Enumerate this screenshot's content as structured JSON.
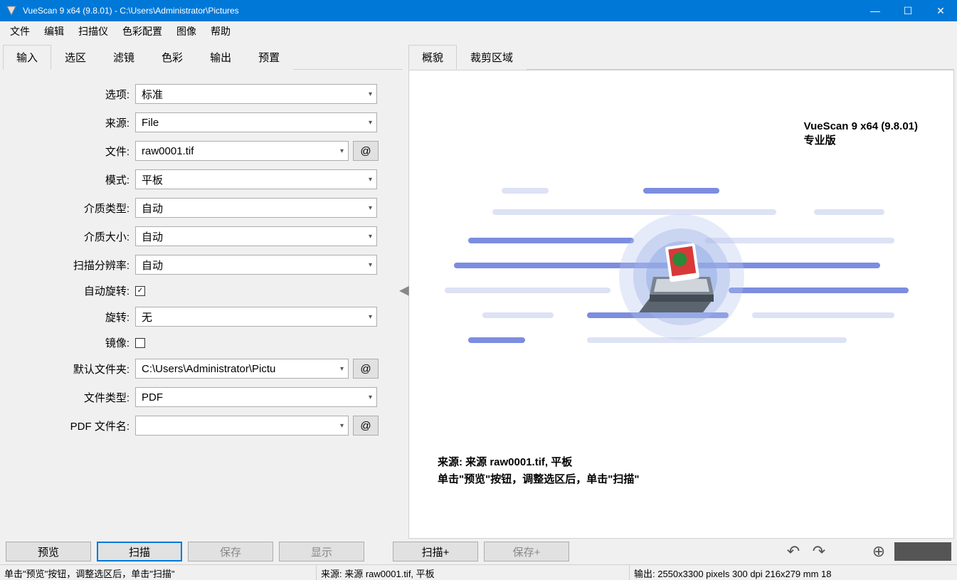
{
  "window": {
    "title": "VueScan 9 x64 (9.8.01) - C:\\Users\\Administrator\\Pictures",
    "minimize": "—",
    "maximize": "☐",
    "close": "✕"
  },
  "menu": [
    "文件",
    "编辑",
    "扫描仪",
    "色彩配置",
    "图像",
    "帮助"
  ],
  "left_tabs": [
    {
      "label": "输入",
      "active": true
    },
    {
      "label": "选区",
      "active": false
    },
    {
      "label": "滤镜",
      "active": false
    },
    {
      "label": "色彩",
      "active": false
    },
    {
      "label": "输出",
      "active": false
    },
    {
      "label": "预置",
      "active": false
    }
  ],
  "right_tabs": [
    {
      "label": "概貌",
      "active": true
    },
    {
      "label": "裁剪区域",
      "active": false
    }
  ],
  "form": {
    "options": {
      "label": "选项:",
      "value": "标准"
    },
    "source": {
      "label": "来源:",
      "value": "File"
    },
    "file": {
      "label": "文件:",
      "value": "raw0001.tif",
      "at": "@"
    },
    "mode": {
      "label": "模式:",
      "value": "平板"
    },
    "media_type": {
      "label": "介质类型:",
      "value": "自动"
    },
    "media_size": {
      "label": "介质大小:",
      "value": "自动"
    },
    "scan_resolution": {
      "label": "扫描分辨率:",
      "value": "自动"
    },
    "auto_rotate": {
      "label": "自动旋转:",
      "checked": true
    },
    "rotate": {
      "label": "旋转:",
      "value": "无"
    },
    "mirror": {
      "label": "镜像:",
      "checked": false
    },
    "default_folder": {
      "label": "默认文件夹:",
      "value": "C:\\Users\\Administrator\\Pictu",
      "at": "@"
    },
    "file_type": {
      "label": "文件类型:",
      "value": "PDF"
    },
    "pdf_filename": {
      "label": "PDF 文件名:",
      "value": "",
      "at": "@"
    }
  },
  "preview": {
    "version_line1": "VueScan 9 x64 (9.8.01)",
    "version_line2": "专业版",
    "info_line1": "来源: 来源 raw0001.tif, 平板",
    "info_line2": "单击\"预览\"按钮，调整选区后，单击\"扫描\""
  },
  "buttons": {
    "preview": "预览",
    "scan": "扫描",
    "save": "保存",
    "display": "显示",
    "scan_plus": "扫描+",
    "save_plus": "保存+"
  },
  "status": {
    "hint": "单击\"预览\"按钮，调整选区后，单击\"扫描\"",
    "source": "来源: 来源 raw0001.tif, 平板",
    "output": "输出: 2550x3300 pixels 300 dpi 216x279 mm 18"
  }
}
